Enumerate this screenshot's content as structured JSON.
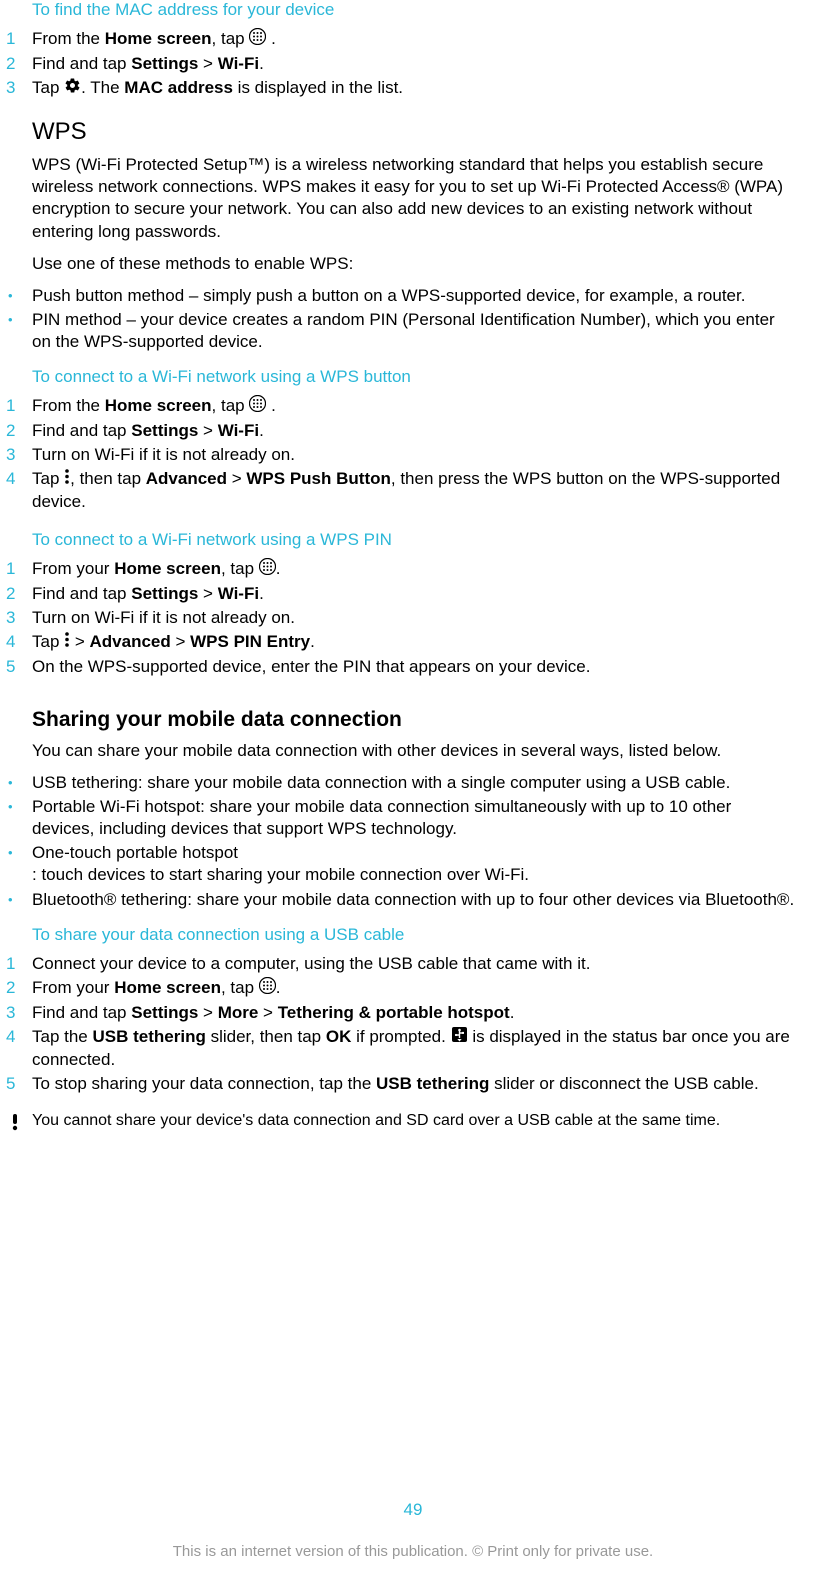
{
  "section1": {
    "title": "To find the MAC address for your device",
    "steps": [
      {
        "n": "1",
        "pre": "From the ",
        "b1": "Home screen",
        "post1": ", tap ",
        "post2": " ."
      },
      {
        "n": "2",
        "pre": "Find and tap ",
        "b1": "Settings",
        "mid": " > ",
        "b2": "Wi-Fi",
        "post": "."
      },
      {
        "n": "3",
        "pre": "Tap ",
        "post1": ". The ",
        "b1": "MAC address",
        "post2": " is displayed in the list."
      }
    ]
  },
  "wps": {
    "heading": "WPS",
    "para1": "WPS (Wi-Fi Protected Setup™) is a wireless networking standard that helps you establish secure wireless network connections. WPS makes it easy for you to set up Wi-Fi Protected Access® (WPA) encryption to secure your network. You can also add new devices to an existing network without entering long passwords.",
    "para2": "Use one of these methods to enable WPS:",
    "bullets": [
      "Push button method – simply push a button on a WPS-supported device, for example, a router.",
      "PIN method – your device creates a random PIN (Personal Identification Number), which you enter on the WPS-supported device."
    ]
  },
  "section2": {
    "title": "To connect to a Wi-Fi network using a WPS button",
    "s1": {
      "n": "1",
      "pre": "From the ",
      "b1": "Home screen",
      "post1": ", tap ",
      "post2": " ."
    },
    "s2": {
      "n": "2",
      "pre": "Find and tap ",
      "b1": "Settings",
      "mid": " > ",
      "b2": "Wi-Fi",
      "post": "."
    },
    "s3": {
      "n": "3",
      "txt": "Turn on Wi-Fi if it is not already on."
    },
    "s4": {
      "n": "4",
      "pre": "Tap ",
      "post1": ", then tap ",
      "b1": "Advanced",
      "mid": " > ",
      "b2": "WPS Push Button",
      "post2": ", then press the WPS button on the WPS-supported device."
    }
  },
  "section3": {
    "title": "To connect to a Wi-Fi network using a WPS PIN",
    "s1": {
      "n": "1",
      "pre": "From your ",
      "b1": "Home screen",
      "post1": ", tap ",
      "post2": "."
    },
    "s2": {
      "n": "2",
      "pre": "Find and tap ",
      "b1": "Settings",
      "mid": " > ",
      "b2": "Wi-Fi",
      "post": "."
    },
    "s3": {
      "n": "3",
      "txt": "Turn on Wi-Fi if it is not already on."
    },
    "s4": {
      "n": "4",
      "pre": "Tap ",
      "mid1": " > ",
      "b1": "Advanced",
      "mid2": " > ",
      "b2": "WPS PIN Entry",
      "post": "."
    },
    "s5": {
      "n": "5",
      "txt": "On the WPS-supported device, enter the PIN that appears on your device."
    }
  },
  "sharing": {
    "heading": "Sharing your mobile data connection",
    "para": "You can share your mobile data connection with other devices in several ways, listed below.",
    "bullets": [
      "USB tethering: share your mobile data connection with a single computer using a USB cable.",
      "Portable Wi-Fi hotspot: share your mobile data connection simultaneously with up to 10 other devices, including devices that support WPS technology.",
      "One-touch portable hotspot\n: touch devices to start sharing your mobile connection over Wi-Fi.",
      "Bluetooth® tethering: share your mobile data connection with up to four other devices via Bluetooth®."
    ]
  },
  "section4": {
    "title": "To share your data connection using a USB cable",
    "s1": {
      "n": "1",
      "txt": "Connect your device to a computer, using the USB cable that came with it."
    },
    "s2": {
      "n": "2",
      "pre": "From your ",
      "b1": "Home screen",
      "post1": ", tap ",
      "post2": "."
    },
    "s3": {
      "n": "3",
      "pre": "Find and tap ",
      "b1": "Settings",
      "mid1": " > ",
      "b2": "More",
      "mid2": " > ",
      "b3": "Tethering & portable hotspot",
      "post": "."
    },
    "s4": {
      "n": "4",
      "pre": "Tap the ",
      "b1": "USB tethering",
      "mid1": " slider, then tap ",
      "b2": "OK",
      "mid2": " if prompted. ",
      "post": " is displayed in the status bar once you are connected."
    },
    "s5": {
      "n": "5",
      "pre": "To stop sharing your data connection, tap the ",
      "b1": "USB tethering",
      "post": " slider or disconnect the USB cable."
    }
  },
  "note": "You cannot share your device's data connection and SD card over a USB cable at the same time.",
  "pagenum": "49",
  "footer": "This is an internet version of this publication. © Print only for private use."
}
